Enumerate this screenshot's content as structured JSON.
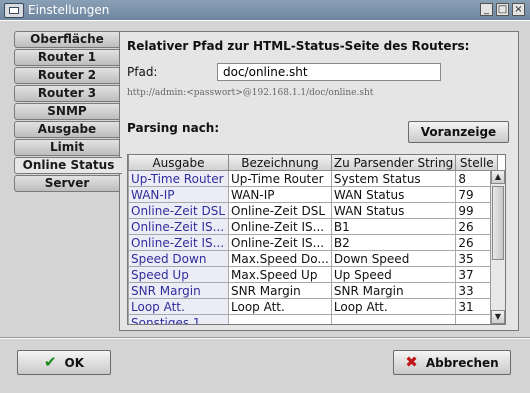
{
  "window": {
    "title": "Einstellungen"
  },
  "tabs": [
    {
      "label": "Oberfläche",
      "active": false
    },
    {
      "label": "Router 1",
      "active": false
    },
    {
      "label": "Router 2",
      "active": false
    },
    {
      "label": "Router 3",
      "active": false
    },
    {
      "label": "SNMP",
      "active": false
    },
    {
      "label": "Ausgabe",
      "active": false
    },
    {
      "label": "Limit",
      "active": false
    },
    {
      "label": "Online Status",
      "active": true
    },
    {
      "label": "Server",
      "active": false
    }
  ],
  "panel": {
    "heading": "Relativer Pfad zur HTML-Status-Seite des Routers:",
    "path_label": "Pfad:",
    "path_value": "doc/online.sht",
    "url_hint": "http://admin:<passwort>@192.168.1.1/doc/online.sht",
    "parsing_label": "Parsing nach:",
    "preview_button": "Voranzeige"
  },
  "table": {
    "columns": [
      "Ausgabe",
      "Bezeichnung",
      "Zu Parsender String",
      "Stelle"
    ],
    "rows": [
      [
        "Up-Time Router",
        "Up-Time Router",
        "System Status",
        "8"
      ],
      [
        "WAN-IP",
        "WAN-IP",
        "WAN Status",
        "79"
      ],
      [
        "Online-Zeit DSL",
        "Online-Zeit DSL",
        "WAN Status",
        "99"
      ],
      [
        "Online-Zeit IS...",
        "Online-Zeit IS...",
        "B1",
        "26"
      ],
      [
        "Online-Zeit IS...",
        "Online-Zeit IS...",
        "B2",
        "26"
      ],
      [
        "Speed Down",
        "Max.Speed Do...",
        "Down Speed",
        "35"
      ],
      [
        "Speed Up",
        "Max.Speed Up",
        "Up Speed",
        "37"
      ],
      [
        "SNR Margin",
        "SNR Margin",
        "SNR Margin",
        "33"
      ],
      [
        "Loop Att.",
        "Loop Att.",
        "Loop Att.",
        "31"
      ],
      [
        "Sonstiges 1",
        "",
        "",
        ""
      ]
    ]
  },
  "footer": {
    "ok_label": "OK",
    "cancel_label": "Abbrechen"
  }
}
